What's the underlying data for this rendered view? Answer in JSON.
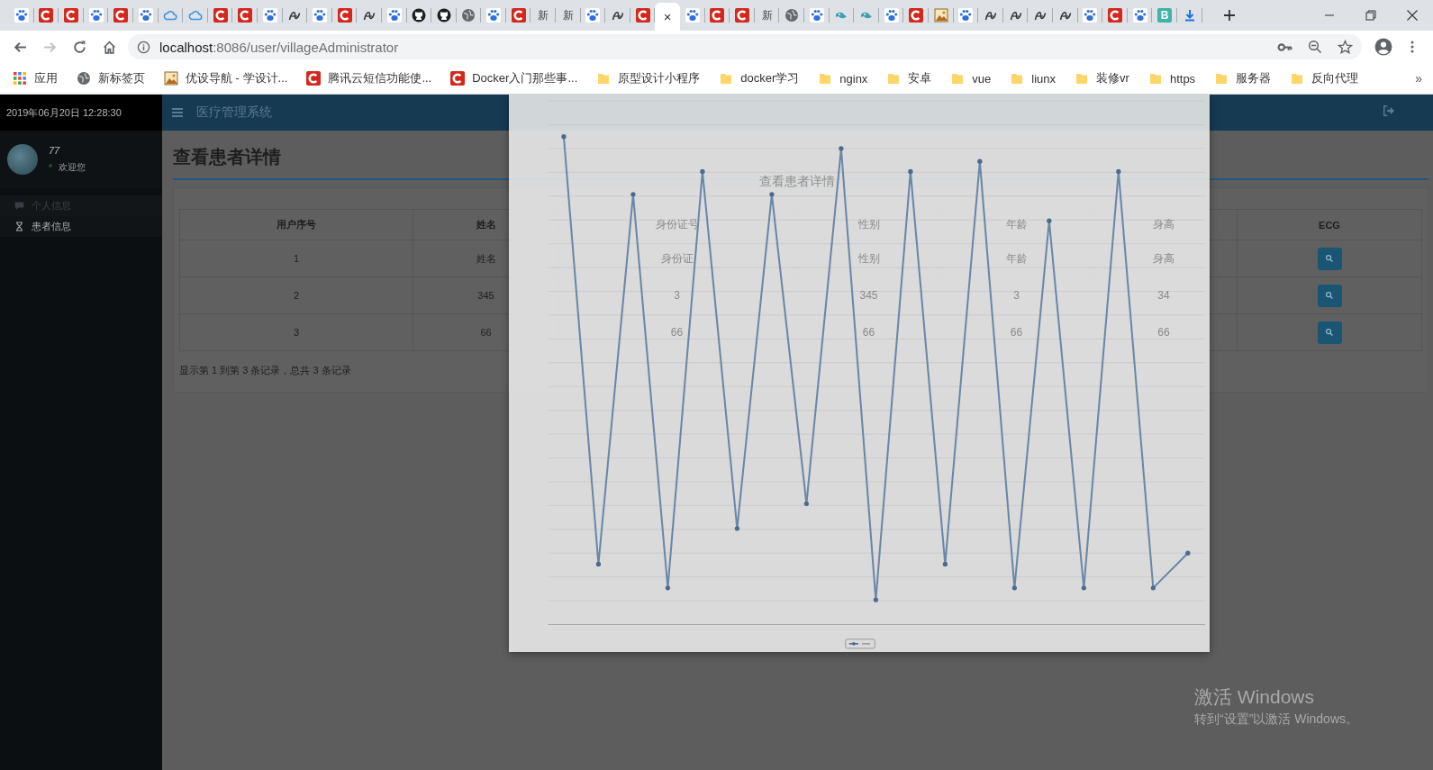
{
  "browser": {
    "tabs": [
      {
        "kind": "paw",
        "selected": false
      },
      {
        "kind": "ring",
        "selected": false
      },
      {
        "kind": "ring",
        "selected": false
      },
      {
        "kind": "paw",
        "selected": false
      },
      {
        "kind": "ring",
        "selected": false
      },
      {
        "kind": "paw",
        "selected": false
      },
      {
        "kind": "cloud",
        "selected": false
      },
      {
        "kind": "cloud",
        "selected": false
      },
      {
        "kind": "ring",
        "selected": false
      },
      {
        "kind": "ring",
        "selected": false
      },
      {
        "kind": "paw",
        "selected": false
      },
      {
        "kind": "swirl",
        "selected": false
      },
      {
        "kind": "paw",
        "selected": false
      },
      {
        "kind": "ring",
        "selected": false
      },
      {
        "kind": "swirl",
        "selected": false
      },
      {
        "kind": "paw",
        "selected": false
      },
      {
        "kind": "round",
        "selected": false
      },
      {
        "kind": "round",
        "selected": false
      },
      {
        "kind": "globe",
        "selected": false
      },
      {
        "kind": "paw",
        "selected": false
      },
      {
        "kind": "ring",
        "selected": false
      },
      {
        "kind": "text",
        "label": "新",
        "selected": false
      },
      {
        "kind": "text",
        "label": "新",
        "selected": false
      },
      {
        "kind": "paw",
        "selected": false
      },
      {
        "kind": "swirl",
        "selected": false
      },
      {
        "kind": "ring",
        "selected": false
      },
      {
        "kind": "blank",
        "close": "×",
        "selected": true
      },
      {
        "kind": "paw",
        "selected": false
      },
      {
        "kind": "ring",
        "selected": false
      },
      {
        "kind": "ring",
        "selected": false
      },
      {
        "kind": "text",
        "label": "新",
        "selected": false
      },
      {
        "kind": "globe",
        "selected": false
      },
      {
        "kind": "paw",
        "selected": false
      },
      {
        "kind": "bird",
        "selected": false
      },
      {
        "kind": "bird",
        "selected": false
      },
      {
        "kind": "paw",
        "selected": false
      },
      {
        "kind": "ring",
        "selected": false
      },
      {
        "kind": "image",
        "selected": false
      },
      {
        "kind": "paw",
        "selected": false
      },
      {
        "kind": "swirl",
        "selected": false
      },
      {
        "kind": "swirl",
        "selected": false
      },
      {
        "kind": "swirl",
        "selected": false
      },
      {
        "kind": "swirl",
        "selected": false
      },
      {
        "kind": "paw",
        "selected": false
      },
      {
        "kind": "ring",
        "selected": false
      },
      {
        "kind": "paw",
        "selected": false
      },
      {
        "kind": "badge",
        "label": "B",
        "selected": false
      },
      {
        "kind": "download",
        "selected": false
      }
    ],
    "address": {
      "host": "localhost",
      "path": ":8086/user/villageAdministrator"
    },
    "bookmarks": [
      {
        "kind": "apps",
        "label": "应用"
      },
      {
        "kind": "globe",
        "label": "新标签页"
      },
      {
        "kind": "image",
        "label": "优设导航 - 学设计..."
      },
      {
        "kind": "ring",
        "label": "腾讯云短信功能使..."
      },
      {
        "kind": "ring",
        "label": "Docker入门那些事..."
      },
      {
        "kind": "folder",
        "label": "原型设计小程序"
      },
      {
        "kind": "folder",
        "label": "docker学习"
      },
      {
        "kind": "folder",
        "label": "nginx"
      },
      {
        "kind": "folder",
        "label": "安卓"
      },
      {
        "kind": "folder",
        "label": "vue"
      },
      {
        "kind": "folder",
        "label": "liunx"
      },
      {
        "kind": "folder",
        "label": "装修vr"
      },
      {
        "kind": "folder",
        "label": "https"
      },
      {
        "kind": "folder",
        "label": "服务器"
      },
      {
        "kind": "folder",
        "label": "反向代理"
      }
    ],
    "bookmarks_more": "»"
  },
  "sidebar": {
    "clock": "2019年06月20日 12:28:30",
    "user": {
      "name": "77",
      "status": "欢迎您"
    },
    "menu": [
      {
        "kind": "comment",
        "label": "个人信息",
        "selected": false
      },
      {
        "kind": "hourglass",
        "label": "患者信息",
        "selected": true
      }
    ]
  },
  "header": {
    "title": "医疗管理系统"
  },
  "page": {
    "heading": "查看患者详情",
    "table": {
      "columns": [
        {
          "label": "用户序号"
        },
        {
          "label": "姓名"
        },
        {
          "label": "身份证号"
        },
        {
          "label": "性别"
        },
        {
          "label": "年龄"
        },
        {
          "label": "身高"
        },
        {
          "label": "ECG",
          "kind": "action"
        }
      ],
      "rows": [
        {
          "cells": [
            "1",
            "姓名",
            "身份证",
            "性别",
            "年龄",
            "身高"
          ]
        },
        {
          "cells": [
            "2",
            "345",
            "3",
            "345",
            "3",
            "34"
          ]
        },
        {
          "cells": [
            "3",
            "66",
            "66",
            "66",
            "66",
            "66"
          ]
        }
      ]
    },
    "footer": "显示第 1 到第 3 条记录，总共 3 条记录"
  },
  "modal": {
    "ghost_title": "查看患者详情"
  },
  "os_watermark": {
    "title": "激活 Windows",
    "subtitle": "转到“设置”以激活 Windows。"
  }
}
